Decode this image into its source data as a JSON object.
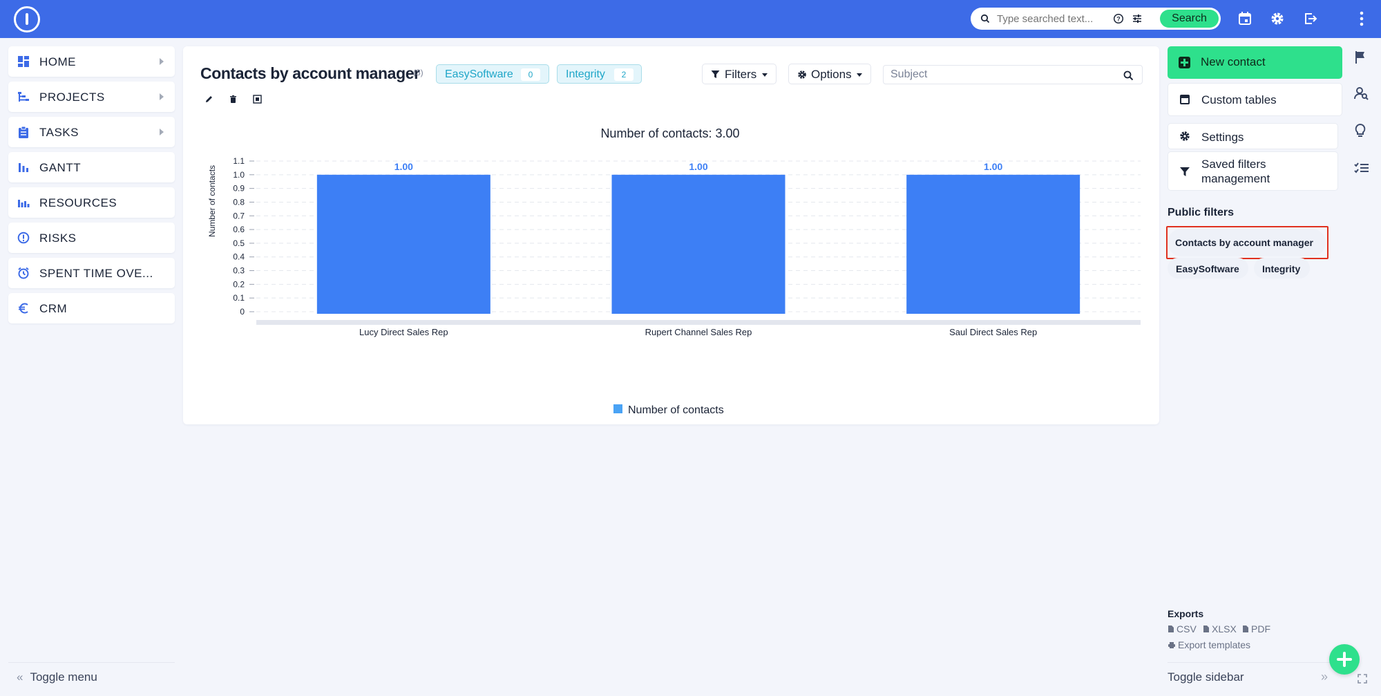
{
  "topbar": {
    "search_placeholder": "Type searched text...",
    "search_button": "Search",
    "icons": [
      "logo-icon",
      "search-icon",
      "help-icon",
      "tune-icon",
      "calendar-icon",
      "gear-icon",
      "logout-icon",
      "more-vertical-icon"
    ]
  },
  "sidebar": {
    "items": [
      {
        "label": "HOME",
        "icon": "dashboard-icon",
        "has_submenu": true
      },
      {
        "label": "PROJECTS",
        "icon": "projects-icon",
        "has_submenu": true
      },
      {
        "label": "TASKS",
        "icon": "clipboard-icon",
        "has_submenu": true
      },
      {
        "label": "GANTT",
        "icon": "gantt-icon",
        "has_submenu": false
      },
      {
        "label": "RESOURCES",
        "icon": "resources-icon",
        "has_submenu": false
      },
      {
        "label": "RISKS",
        "icon": "alert-icon",
        "has_submenu": false
      },
      {
        "label": "SPENT TIME OVE...",
        "icon": "alarm-icon",
        "has_submenu": false
      },
      {
        "label": "CRM",
        "icon": "euro-icon",
        "has_submenu": false
      }
    ],
    "toggle_label": "Toggle menu"
  },
  "main": {
    "title": "Contacts by account manager",
    "count": "(3)",
    "tags": [
      {
        "label": "EasySoftware",
        "count": "0"
      },
      {
        "label": "Integrity",
        "count": "2"
      }
    ],
    "filters_label": "Filters",
    "options_label": "Options",
    "subject_placeholder": "Subject"
  },
  "chart_data": {
    "type": "bar",
    "title": "Number of contacts: 3.00",
    "ylabel": "Number of contacts",
    "xlabel": "",
    "categories": [
      "Lucy Direct Sales Rep",
      "Rupert Channel Sales Rep",
      "Saul Direct Sales Rep"
    ],
    "series": [
      {
        "name": "Number of contacts",
        "values": [
          1.0,
          1.0,
          1.0
        ]
      }
    ],
    "data_labels": [
      "1.00",
      "1.00",
      "1.00"
    ],
    "yticks": [
      "0",
      "0.1",
      "0.2",
      "0.3",
      "0.4",
      "0.5",
      "0.6",
      "0.7",
      "0.8",
      "0.9",
      "1.0",
      "1.1"
    ],
    "ylim": [
      0,
      1.1
    ],
    "grid": true,
    "legend": "bottom",
    "bar_color": "#3d7ff5",
    "legend_color": "#4aa3f5"
  },
  "right_sidebar": {
    "new_button": "New contact",
    "custom_tables": "Custom tables",
    "settings": "Settings",
    "saved_filters": "Saved filters management",
    "public_filters_heading": "Public filters",
    "public_filters": [
      "Contacts by account manager",
      "EasySoftware",
      "Integrity"
    ],
    "exports_heading": "Exports",
    "exports": [
      "CSV",
      "XLSX",
      "PDF"
    ],
    "export_templates": "Export templates",
    "toggle_label": "Toggle sidebar"
  },
  "colors": {
    "topbar": "#3d6be7",
    "accent_green": "#2ee08c",
    "highlight_red": "#e0301e",
    "tag_text": "#1fa6c8"
  }
}
